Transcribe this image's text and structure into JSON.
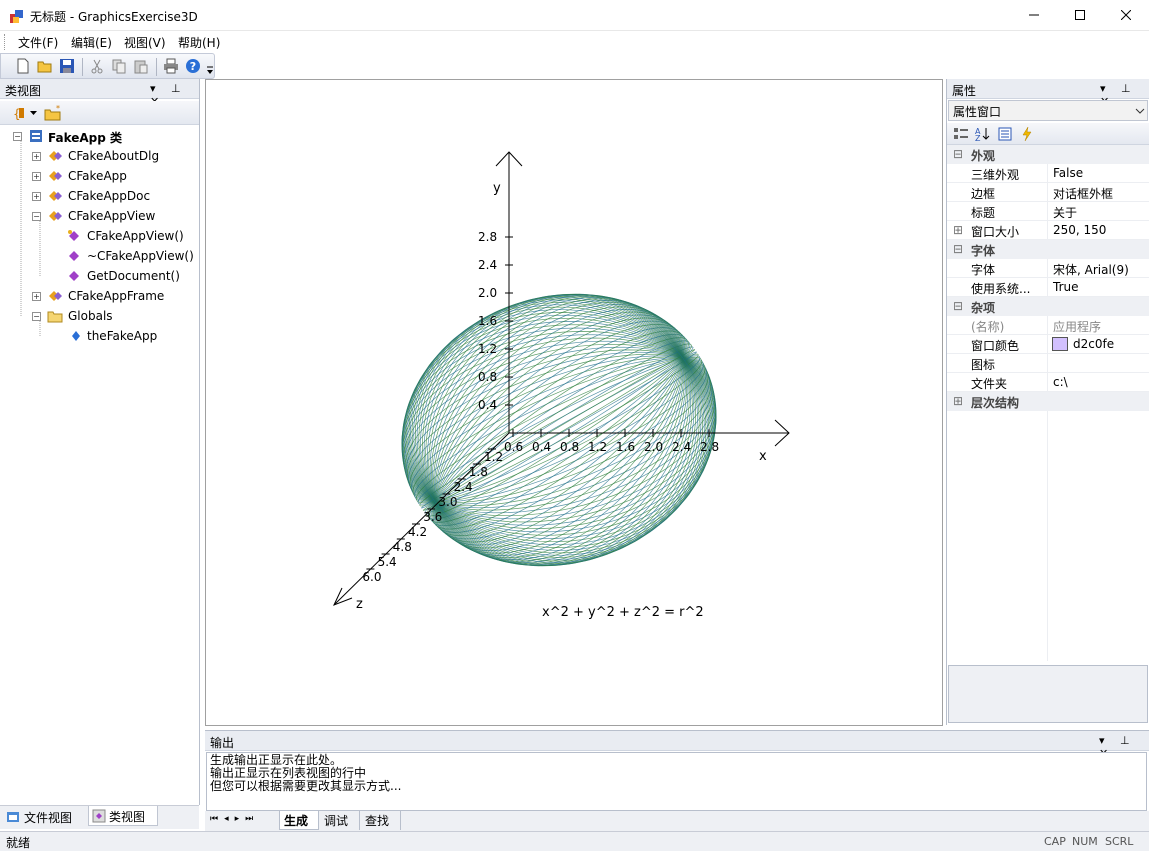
{
  "window": {
    "title": "无标题 - GraphicsExercise3D"
  },
  "menu": [
    "文件(F)",
    "编辑(E)",
    "视图(V)",
    "帮助(H)"
  ],
  "classview": {
    "title": "类视图",
    "root": "FakeApp 类",
    "items": [
      "CFakeAboutDlg",
      "CFakeApp",
      "CFakeAppDoc",
      "CFakeAppView",
      "CFakeAppView()",
      "~CFakeAppView()",
      "GetDocument()",
      "CFakeAppFrame",
      "Globals",
      "theFakeApp"
    ],
    "tabs": [
      "文件视图",
      "类视图"
    ]
  },
  "plot": {
    "y_label": "y",
    "x_label": "x",
    "z_label": "z",
    "y_ticks": [
      "0.4",
      "0.8",
      "1.2",
      "1.6",
      "2.0",
      "2.4",
      "2.8"
    ],
    "x_ticks": [
      "0.6",
      "0.4",
      "0.8",
      "1.2",
      "1.6",
      "2.0",
      "2.4",
      "2.8"
    ],
    "z_ticks": [
      "1.2",
      "1.8",
      "2.4",
      "3.0",
      "3.6",
      "4.2",
      "4.8",
      "5.4",
      "6.0"
    ],
    "equation": "x^2 + y^2 + z^2 = r^2"
  },
  "properties": {
    "title": "属性",
    "selector": "属性窗口",
    "cat_appearance": "外观",
    "row_3d_label": "三维外观",
    "row_3d_value": "False",
    "row_border_label": "边框",
    "row_border_value": "对话框外框",
    "row_caption_label": "标题",
    "row_caption_value": "关于",
    "row_size_label": "窗口大小",
    "row_size_value": "250, 150",
    "cat_font": "字体",
    "row_font_label": "字体",
    "row_font_value": "宋体, Arial(9)",
    "row_sysfont_label": "使用系统...",
    "row_sysfont_value": "True",
    "cat_misc": "杂项",
    "row_name_label": "(名称)",
    "row_name_value": "应用程序",
    "row_color_label": "窗口颜色",
    "row_color_value": "d2c0fe",
    "row_icon_label": "图标",
    "row_folder_label": "文件夹",
    "row_folder_value": "c:\\",
    "cat_hierarchy": "层次结构",
    "swatch_color": "#d2c0fe"
  },
  "output": {
    "title": "输出",
    "lines": [
      "生成输出正显示在此处。",
      "输出正显示在列表视图的行中",
      "但您可以根据需要更改其显示方式..."
    ],
    "tabs": [
      "生成",
      "调试",
      "查找"
    ]
  },
  "status": {
    "text": "就绪",
    "cap": "CAP",
    "num": "NUM",
    "scrl": "SCRL"
  }
}
